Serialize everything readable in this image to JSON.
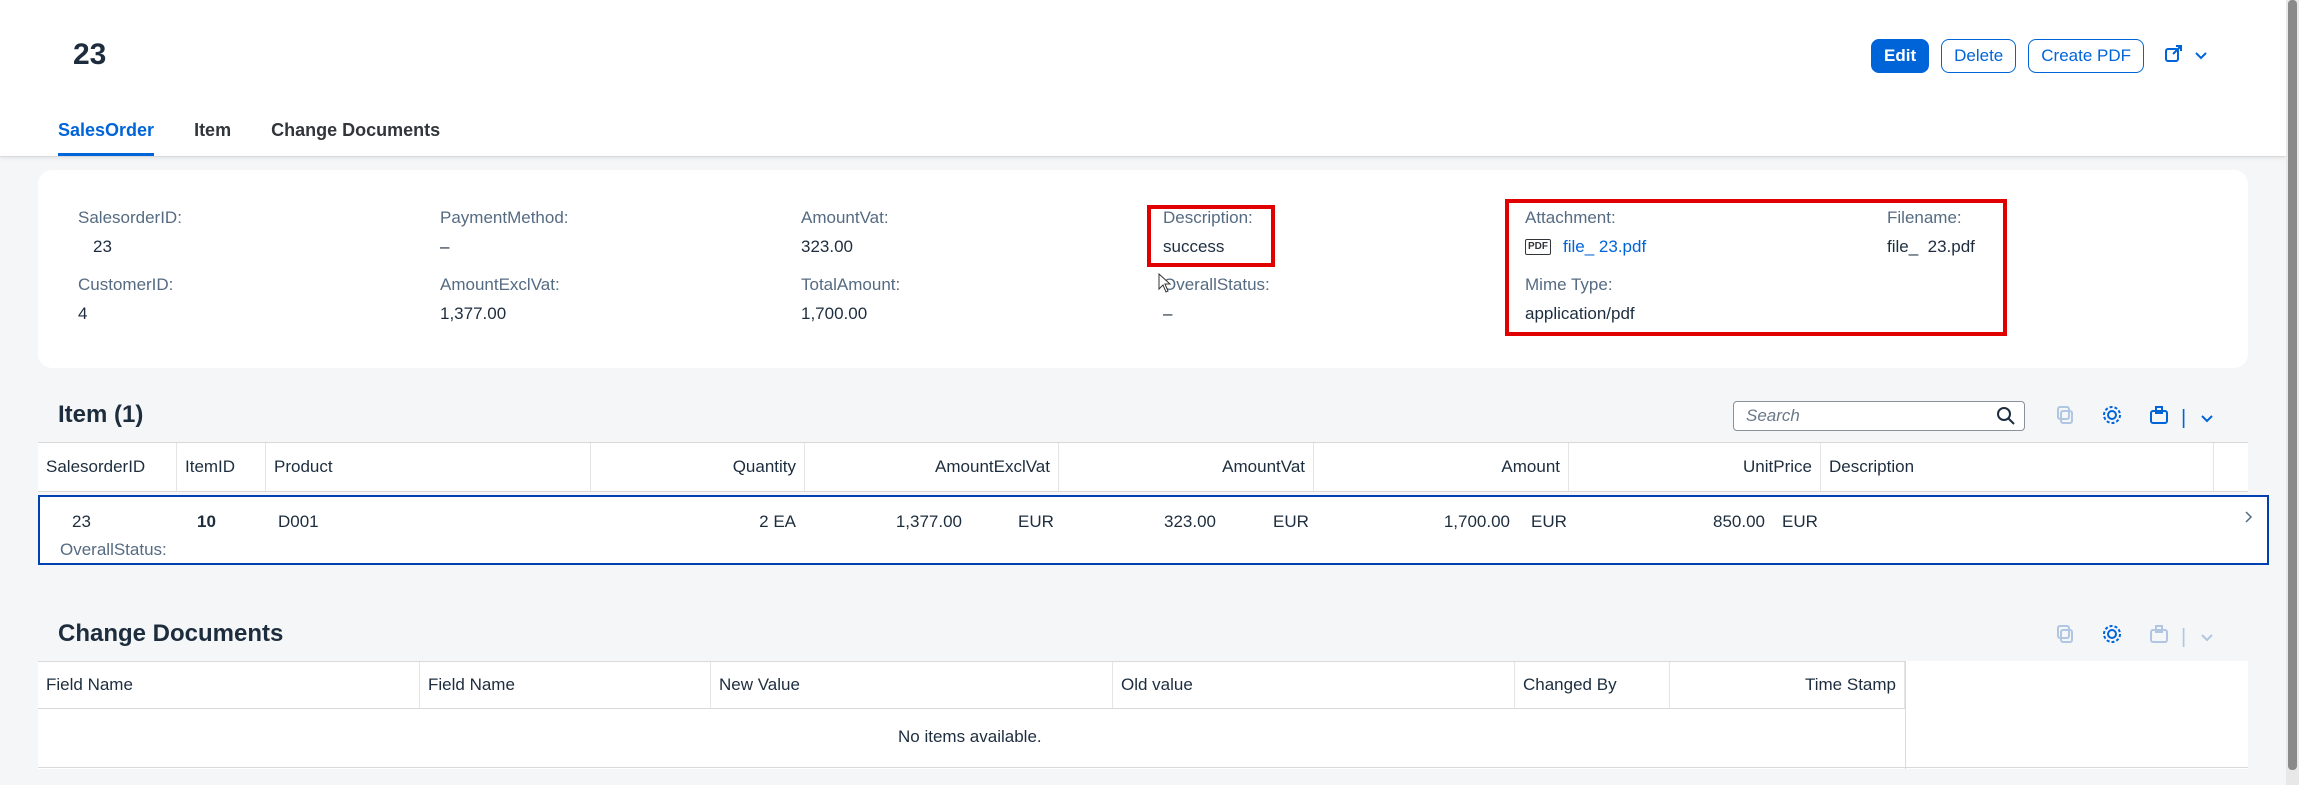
{
  "header": {
    "title": "23",
    "actions": {
      "edit": "Edit",
      "delete": "Delete",
      "create_pdf": "Create PDF",
      "share_icon": "share-icon",
      "chevron": "chevron-down-icon"
    },
    "tabs": [
      "SalesOrder",
      "Item",
      "Change Documents"
    ]
  },
  "info": {
    "salesorder_id": {
      "label": "SalesorderID:",
      "value": "23"
    },
    "customer_id": {
      "label": "CustomerID:",
      "value": "4"
    },
    "payment_method": {
      "label": "PaymentMethod:",
      "value": "–"
    },
    "amount_excl_vat": {
      "label": "AmountExclVat:",
      "value": "1,377.00"
    },
    "amount_vat": {
      "label": "AmountVat:",
      "value": "323.00"
    },
    "total_amount": {
      "label": "TotalAmount:",
      "value": "1,700.00"
    },
    "description": {
      "label": "Description:",
      "value": "success"
    },
    "overall_status": {
      "label": "OverallStatus:",
      "value": "–"
    },
    "attachment": {
      "label": "Attachment:",
      "value": "file_ 23.pdf",
      "icon": "pdf-icon",
      "icon_text": "PDF"
    },
    "mime_type": {
      "label": "Mime Type:",
      "value": "application/pdf"
    },
    "filename": {
      "label": "Filename:",
      "value": "file_  23.pdf"
    }
  },
  "item_section": {
    "title": "Item (1)",
    "search_placeholder": "Search",
    "columns": [
      "SalesorderID",
      "ItemID",
      "Product",
      "Quantity",
      "AmountExclVat",
      "AmountVat",
      "Amount",
      "UnitPrice",
      "Description"
    ],
    "row": {
      "salesorder_id": "23",
      "item_id": "10",
      "product": "D001",
      "quantity": "2 EA",
      "amount_excl_vat": "1,377.00",
      "amount_excl_vat_cur": "EUR",
      "amount_vat": "323.00",
      "amount_vat_cur": "EUR",
      "amount": "1,700.00",
      "amount_cur": "EUR",
      "unit_price": "850.00",
      "unit_price_cur": "EUR",
      "overall_status_label": "OverallStatus:"
    }
  },
  "change_docs": {
    "title": "Change Documents",
    "columns": [
      "Field Name",
      "Field Name",
      "New Value",
      "Old value",
      "Changed By",
      "Time Stamp"
    ],
    "empty": "No items available."
  },
  "colors": {
    "accent": "#0064d9",
    "highlight_box": "#e00000"
  }
}
